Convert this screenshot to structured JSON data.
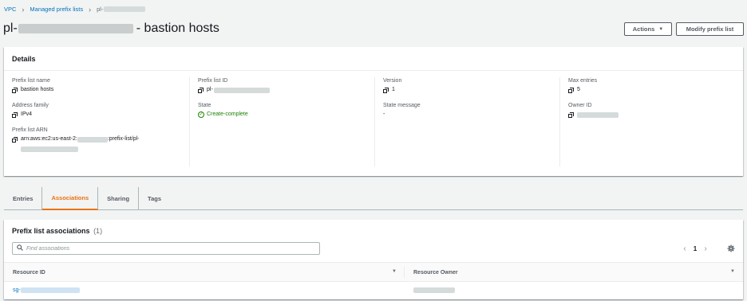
{
  "breadcrumb": {
    "items": [
      "VPC",
      "Managed prefix lists"
    ],
    "current_prefix": "pl-"
  },
  "header": {
    "title_prefix": "pl-",
    "title_suffix": "- bastion hosts",
    "actions_label": "Actions",
    "modify_label": "Modify prefix list"
  },
  "details": {
    "heading": "Details",
    "name_label": "Prefix list name",
    "name_value": "bastion hosts",
    "family_label": "Address family",
    "family_value": "IPv4",
    "arn_label": "Prefix list ARN",
    "arn_value_start": "arn:aws:ec2:us-east-2:",
    "arn_value_mid": ":prefix-list/pl-",
    "id_label": "Prefix list ID",
    "id_value": "pl-",
    "state_label": "State",
    "state_value": "Create-complete",
    "version_label": "Version",
    "version_value": "1",
    "state_message_label": "State message",
    "state_message_value": "-",
    "max_entries_label": "Max entries",
    "max_entries_value": "5",
    "owner_label": "Owner ID"
  },
  "tabs": [
    {
      "label": "Entries"
    },
    {
      "label": "Associations"
    },
    {
      "label": "Sharing"
    },
    {
      "label": "Tags"
    }
  ],
  "associations": {
    "title": "Prefix list associations",
    "count": "(1)",
    "search_placeholder": "Find associations",
    "page": "1",
    "columns": [
      "Resource ID",
      "Resource Owner"
    ],
    "rows": [
      {
        "resource_id_prefix": "sg-"
      }
    ]
  },
  "colors": {
    "link": "#0073bb",
    "active_tab": "#ec7211",
    "success": "#1d8102"
  }
}
